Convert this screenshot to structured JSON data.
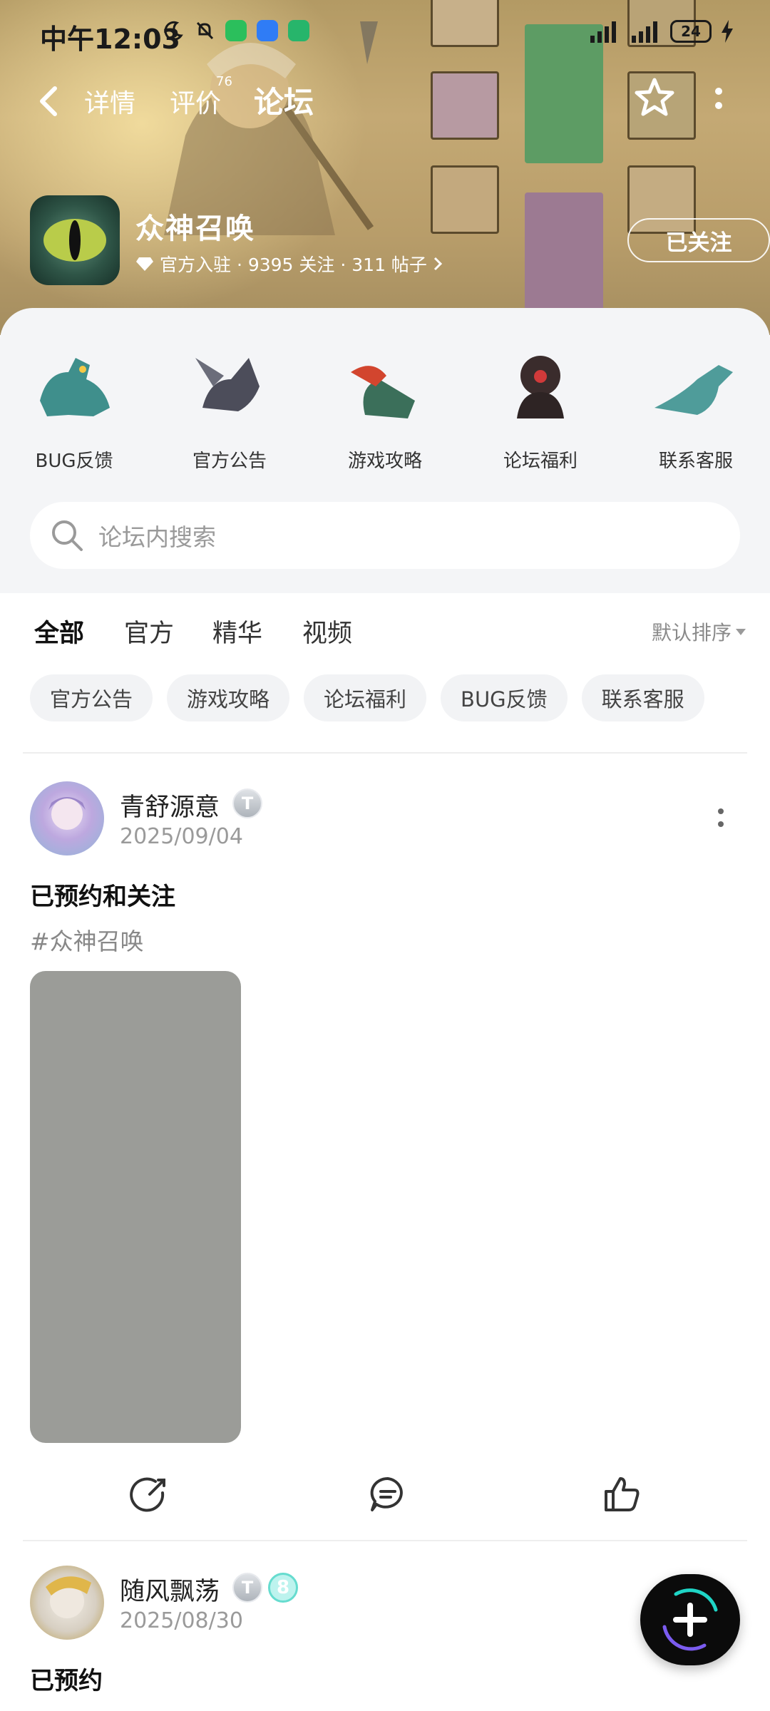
{
  "status_bar": {
    "time": "中午12:03",
    "battery": "24"
  },
  "nav": {
    "tabs": [
      {
        "label": "详情"
      },
      {
        "label": "评价",
        "badge": "76"
      },
      {
        "label": "论坛"
      }
    ]
  },
  "game": {
    "title": "众神召唤",
    "meta": "官方入驻 · 9395 关注 · 311 帖子",
    "follow_label": "已关注"
  },
  "categories": [
    {
      "label": "BUG反馈"
    },
    {
      "label": "官方公告"
    },
    {
      "label": "游戏攻略"
    },
    {
      "label": "论坛福利"
    },
    {
      "label": "联系客服"
    }
  ],
  "search": {
    "placeholder": "论坛内搜索"
  },
  "filter_tabs": [
    {
      "label": "全部"
    },
    {
      "label": "官方"
    },
    {
      "label": "精华"
    },
    {
      "label": "视频"
    }
  ],
  "sort_label": "默认排序",
  "chips": [
    {
      "label": "官方公告"
    },
    {
      "label": "游戏攻略"
    },
    {
      "label": "论坛福利"
    },
    {
      "label": "BUG反馈"
    },
    {
      "label": "联系客服"
    }
  ],
  "posts": [
    {
      "user": "青舒源意",
      "badge": "T",
      "date": "2025/09/04",
      "title": "已预约和关注",
      "tag": "#众神召唤"
    },
    {
      "user": "随风飘荡",
      "badge": "T",
      "badge2": "8",
      "date": "2025/08/30",
      "title": "已预约"
    }
  ],
  "colors": {
    "accent": "#1fd5c6",
    "placeholder_image": "#9b9c98"
  }
}
